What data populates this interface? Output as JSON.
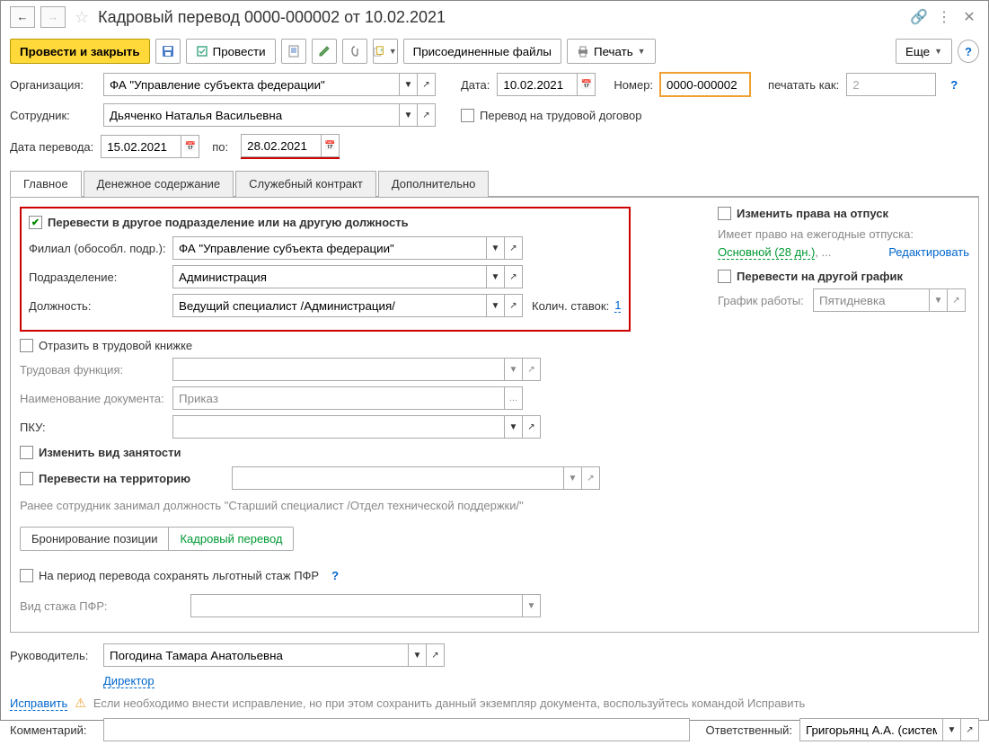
{
  "title": "Кадровый перевод 0000-000002 от 10.02.2021",
  "toolbar": {
    "post_and_close": "Провести и закрыть",
    "post": "Провести",
    "attached_files": "Присоединенные файлы",
    "print": "Печать",
    "more": "Еще"
  },
  "header": {
    "organization_label": "Организация:",
    "organization_value": "ФА \"Управление субъекта федерации\"",
    "date_label": "Дата:",
    "date_value": "10.02.2021",
    "number_label": "Номер:",
    "number_value": "0000-000002",
    "print_as_label": "печатать как:",
    "print_as_value": "2",
    "employee_label": "Сотрудник:",
    "employee_value": "Дьяченко Наталья Васильевна",
    "transfer_to_contract": "Перевод на трудовой договор",
    "transfer_date_label": "Дата перевода:",
    "transfer_date_value": "15.02.2021",
    "to_label": "по:",
    "to_value": "28.02.2021"
  },
  "tabs": [
    "Главное",
    "Денежное содержание",
    "Служебный контракт",
    "Дополнительно"
  ],
  "main": {
    "transfer_other": "Перевести в другое подразделение или на другую должность",
    "branch_label": "Филиал (обособл. подр.):",
    "branch_value": "ФА \"Управление субъекта федерации\"",
    "department_label": "Подразделение:",
    "department_value": "Администрация",
    "position_label": "Должность:",
    "position_value": "Ведущий специалист /Администрация/",
    "rates_label": "Колич. ставок:",
    "rates_value": "1",
    "reflect_workbook": "Отразить в трудовой книжке",
    "labor_function_label": "Трудовая функция:",
    "doc_name_label": "Наименование документа:",
    "doc_name_value": "Приказ",
    "pku_label": "ПКУ:",
    "change_employment": "Изменить вид занятости",
    "transfer_territory": "Перевести на территорию",
    "previous_note": "Ранее сотрудник занимал должность \"Старший специалист /Отдел технической поддержки/\"",
    "booking": "Бронирование позиции",
    "transfer_doc": "Кадровый перевод",
    "pfr_preserve": "На период перевода сохранять льготный стаж ПФР",
    "pfr_type_label": "Вид стажа ПФР:",
    "side": {
      "change_vacation": "Изменить права на отпуск",
      "vacation_note1": "Имеет право на ежегодные отпуска: ",
      "vacation_note2": "Основной (28 дн.)",
      "vacation_note3": ", ...",
      "edit_link": "Редактировать",
      "transfer_schedule": "Перевести на другой график",
      "schedule_label": "График работы:",
      "schedule_value": "Пятидневка"
    }
  },
  "footer": {
    "manager_label": "Руководитель:",
    "manager_value": "Погодина Тамара Анатольевна",
    "manager_position": "Директор",
    "correct_link": "Исправить",
    "correct_note": "Если необходимо внести исправление, но при этом сохранить данный экземпляр документа, воспользуйтесь командой Исправить",
    "comment_label": "Комментарий:",
    "responsible_label": "Ответственный:",
    "responsible_value": "Григорьянц А.А. (системн"
  }
}
